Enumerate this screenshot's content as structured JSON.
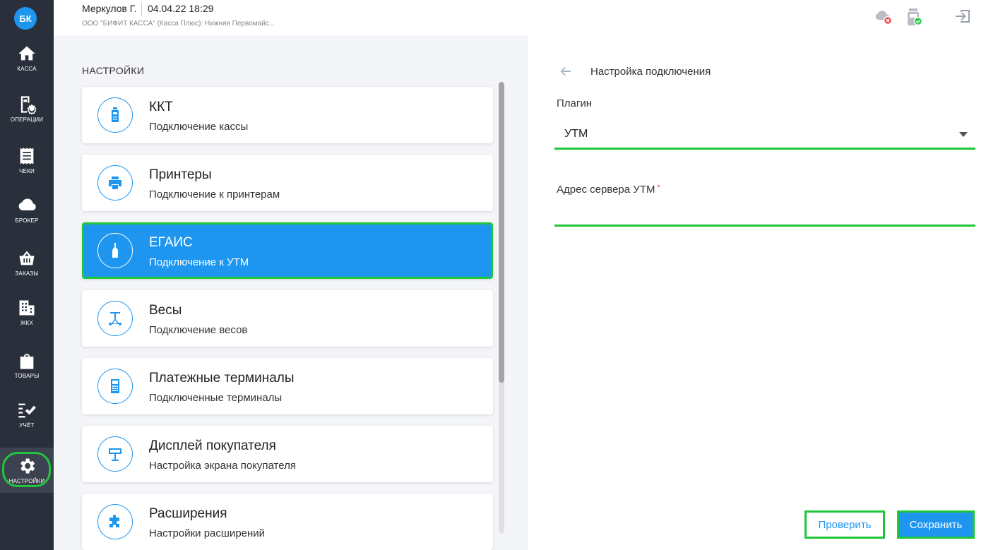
{
  "colors": {
    "accent": "#1e96f0",
    "highlight": "#1fc63a",
    "sidebar": "#2a2f3c"
  },
  "sidebar": {
    "avatar": "БК",
    "items": [
      {
        "label": "КАССА",
        "icon": "home-icon"
      },
      {
        "label": "ОПЕРАЦИИ",
        "icon": "operations-icon"
      },
      {
        "label": "ЧЕКИ",
        "icon": "receipt-icon"
      },
      {
        "label": "БРОКЕР",
        "icon": "cloud-icon"
      },
      {
        "label": "ЗАКАЗЫ",
        "icon": "basket-icon"
      },
      {
        "label": "ЖКХ",
        "icon": "building-icon"
      },
      {
        "label": "ТОВАРЫ",
        "icon": "bag-icon"
      },
      {
        "label": "УЧЁТ",
        "icon": "checklist-icon"
      },
      {
        "label": "НАСТРОЙКИ",
        "icon": "gear-icon",
        "active": true
      }
    ]
  },
  "header": {
    "user": "Меркулов Г.",
    "datetime": "04.04.22 18:29",
    "org": "ООО \"БИФИТ КАССА\" (Касса Плюс): Нижняя Первомайс..."
  },
  "settings": {
    "title": "НАСТРОЙКИ",
    "cards": [
      {
        "title": "ККТ",
        "subtitle": "Подключение кассы",
        "icon": "cash-register-icon"
      },
      {
        "title": "Принтеры",
        "subtitle": "Подключение к принтерам",
        "icon": "printer-icon"
      },
      {
        "title": "ЕГАИС",
        "subtitle": "Подключение к УТМ",
        "icon": "bottle-icon",
        "active": true
      },
      {
        "title": "Весы",
        "subtitle": "Подключение весов",
        "icon": "scales-icon"
      },
      {
        "title": "Платежные терминалы",
        "subtitle": "Подключенные терминалы",
        "icon": "terminal-icon"
      },
      {
        "title": "Дисплей покупателя",
        "subtitle": "Настройка экрана покупателя",
        "icon": "display-icon"
      },
      {
        "title": "Расширения",
        "subtitle": "Настройки расширений",
        "icon": "puzzle-icon"
      }
    ]
  },
  "connection": {
    "title": "Настройка подключения",
    "plugin_label": "Плагин",
    "plugin_value": "УТМ",
    "address_label": "Адрес сервера УТМ",
    "address_required": "*",
    "address_value": "",
    "check_button": "Проверить",
    "save_button": "Сохранить"
  }
}
